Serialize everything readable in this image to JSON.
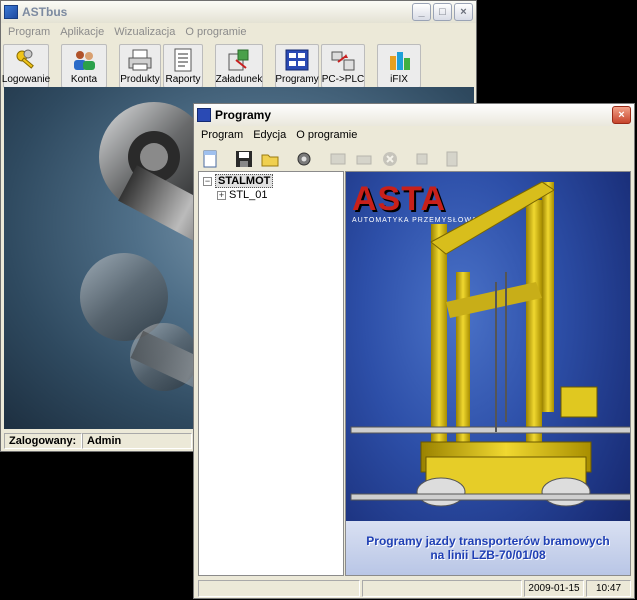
{
  "astbus": {
    "title": "ASTbus",
    "menu": [
      "Program",
      "Aplikacje",
      "Wizualizacja",
      "O programie"
    ],
    "toolbar": [
      {
        "label": "Logowanie",
        "icon": "keys-icon"
      },
      {
        "label": "Konta",
        "icon": "users-icon"
      },
      {
        "label": "Produkty",
        "icon": "printer-icon"
      },
      {
        "label": "Raporty",
        "icon": "report-icon"
      },
      {
        "label": "Załadunek",
        "icon": "loading-icon"
      },
      {
        "label": "Programy",
        "icon": "programs-icon"
      },
      {
        "label": "PC->PLC",
        "icon": "pc-plc-icon"
      },
      {
        "label": "iFIX",
        "icon": "ifix-icon"
      }
    ],
    "status": {
      "label": "Zalogowany:",
      "user": "Admin"
    }
  },
  "programy": {
    "title": "Programy",
    "menu": [
      "Program",
      "Edycja",
      "O programie"
    ],
    "tree": {
      "root": "STALMOT",
      "children": [
        "STL_01"
      ]
    },
    "splash": {
      "brand": "ASTA",
      "brand_sub": "AUTOMATYKA PRZEMYSŁOWA",
      "caption_line1": "Programy jazdy transporterów bramowych",
      "caption_line2": "na linii LZB-70/01/08"
    },
    "status": {
      "date": "2009-01-15",
      "time": "10:47"
    }
  },
  "colors": {
    "accent": "#1f3fb4",
    "brand_yellow": "#e8c81a",
    "brand_red": "#c8201a"
  }
}
